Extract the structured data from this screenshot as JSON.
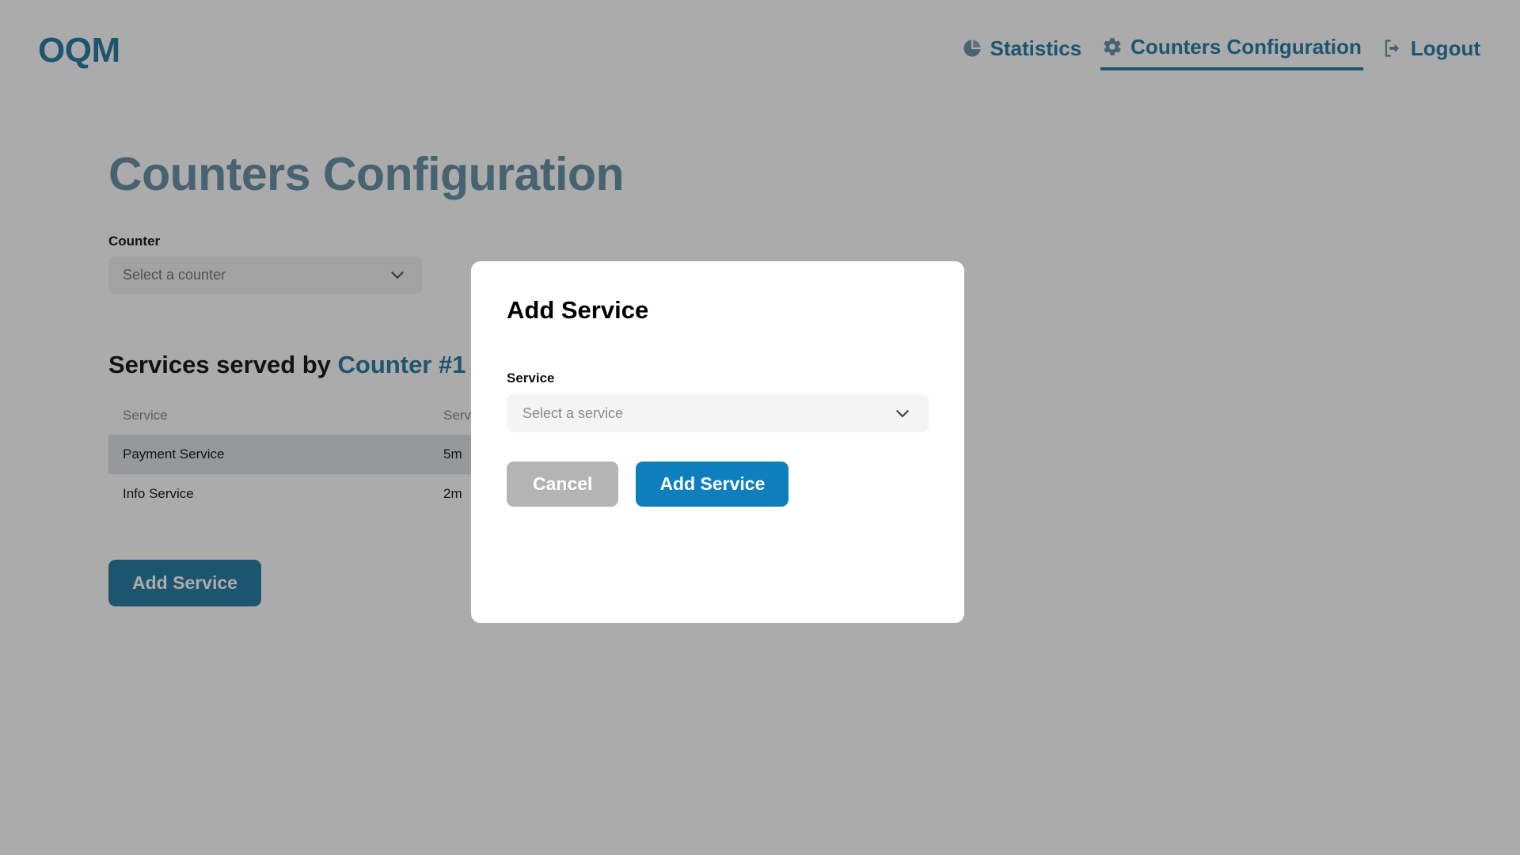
{
  "brand": {
    "label": "OQM"
  },
  "nav": {
    "items": [
      {
        "label": "Statistics",
        "icon": "pie-chart-icon",
        "active": false
      },
      {
        "label": "Counters Configuration",
        "icon": "gear-icon",
        "active": true
      },
      {
        "label": "Logout",
        "icon": "logout-icon",
        "active": false
      }
    ]
  },
  "page": {
    "title": "Counters Configuration",
    "counter_field": {
      "label": "Counter",
      "value": "",
      "placeholder": "Select a counter"
    },
    "section": {
      "prefix": "Services served by ",
      "counter_name": "Counter #1"
    },
    "table": {
      "columns": [
        "Service",
        "Service Time"
      ],
      "rows": [
        {
          "service": "Payment Service",
          "service_time": "5m",
          "hovered": true
        },
        {
          "service": "Info Service",
          "service_time": "2m",
          "hovered": false
        }
      ]
    },
    "add_service_button": "Add Service"
  },
  "modal": {
    "title": "Add Service",
    "service_field": {
      "label": "Service",
      "value": "",
      "placeholder": "Select a service"
    },
    "cancel_button": "Cancel",
    "confirm_button": "Add Service"
  },
  "colors": {
    "brand_teal": "#2c7fa6",
    "title_muted_teal": "#6a93a8",
    "primary_blue": "#0d7fbd",
    "cancel_gray": "#b4b4b4",
    "row_hover": "#e2e3e4",
    "field_bg": "#f2f2f3"
  }
}
